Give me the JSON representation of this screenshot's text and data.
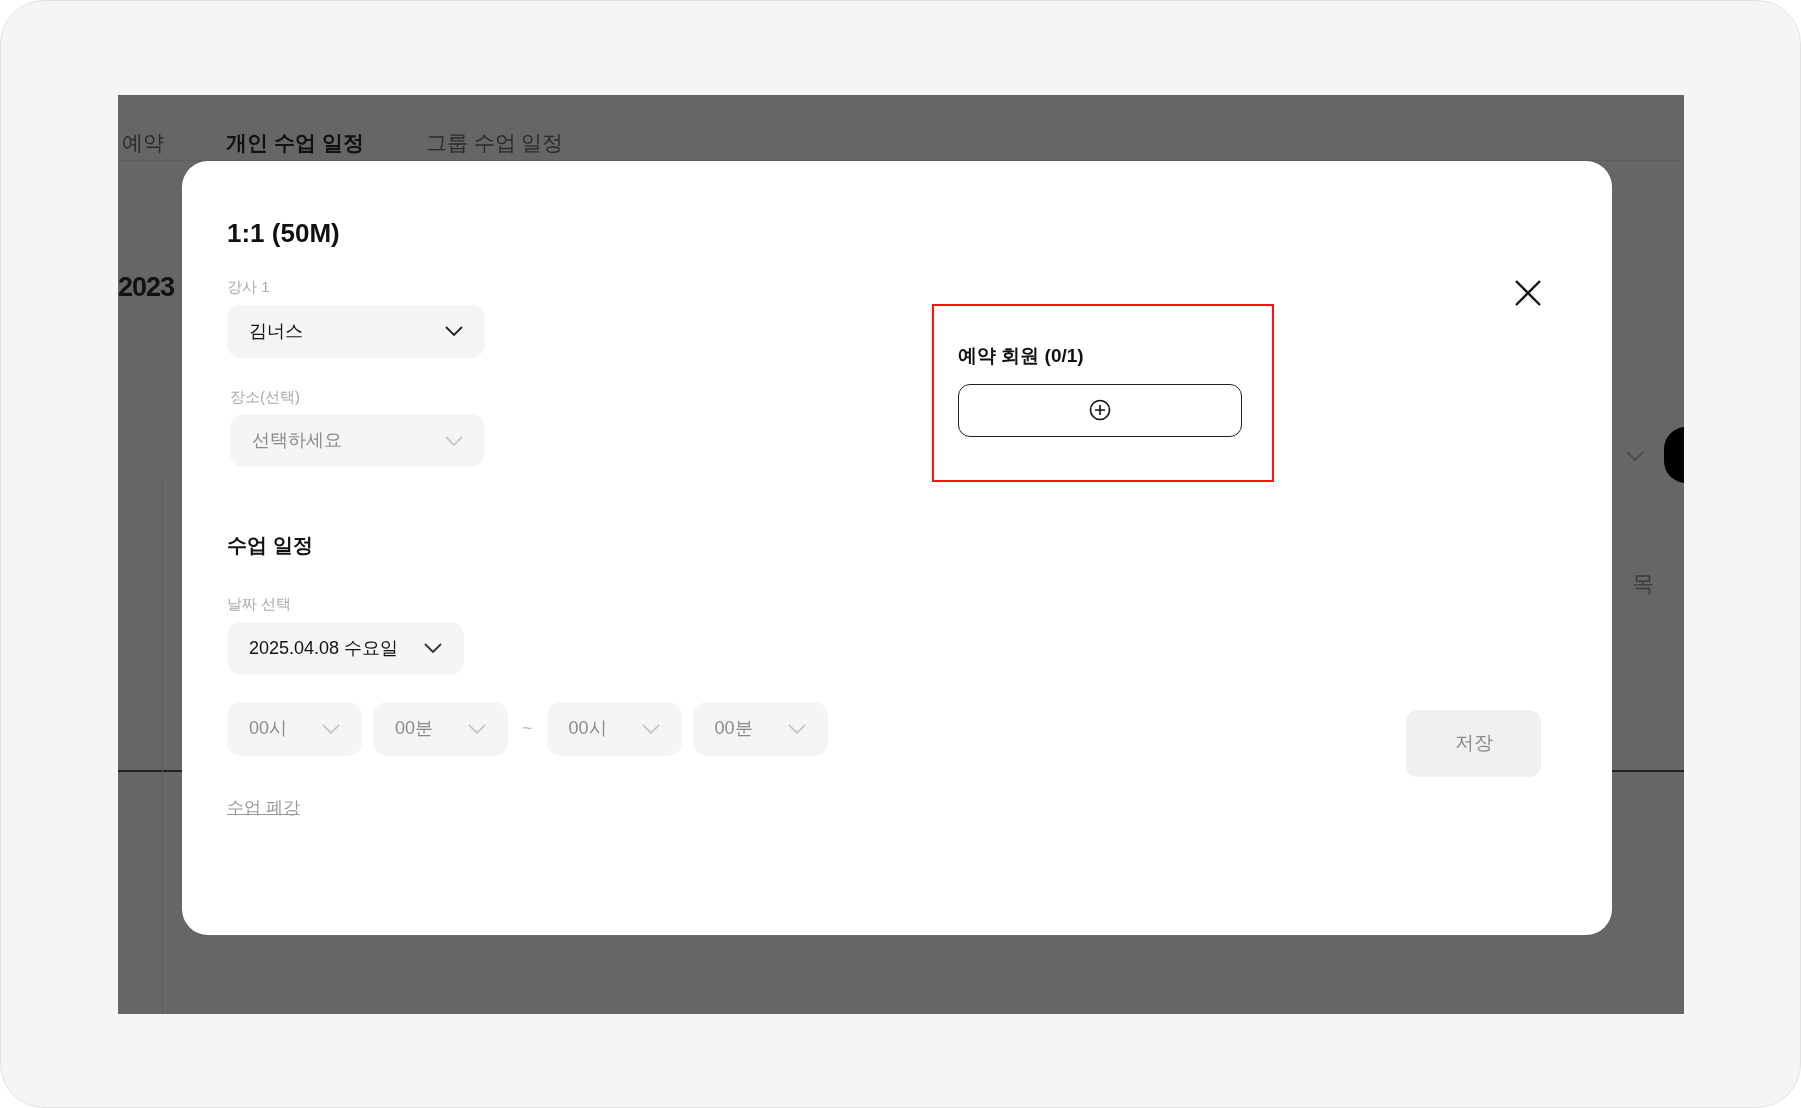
{
  "background": {
    "tabs": [
      {
        "label": "예약",
        "selected": false
      },
      {
        "label": "개인 수업 일정",
        "selected": true
      },
      {
        "label": "그룹 수업 일정",
        "selected": false
      }
    ],
    "year": "2023",
    "column_label": "목"
  },
  "modal": {
    "title": "1:1 (50M)",
    "fields": [
      {
        "label": "강사 1",
        "value": "김너스"
      },
      {
        "label": "장소(선택)",
        "placeholder": "선택하세요"
      }
    ],
    "schedule": {
      "heading": "수업 일정",
      "date_label": "날짜 선택",
      "date_value": "2025.04.08 수요일",
      "start": [
        {
          "placeholder": "00시"
        },
        {
          "placeholder": "00분"
        }
      ],
      "separator": "~",
      "end": [
        {
          "placeholder": "00시"
        },
        {
          "placeholder": "00분"
        }
      ]
    },
    "cancel_link": "수업 폐강",
    "members": {
      "title": "예약 회원 (0/1)",
      "highlighted": true
    },
    "save_button": {
      "label": "저장",
      "disabled": true
    }
  }
}
